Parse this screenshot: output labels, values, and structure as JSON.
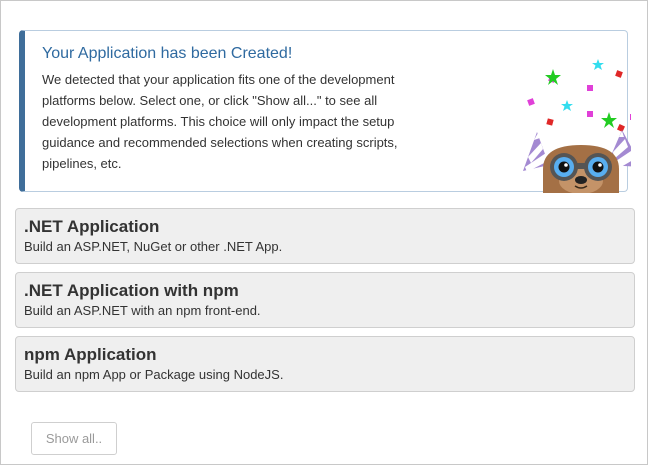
{
  "callout": {
    "title": "Your Application has been Created!",
    "body": "We detected that your application fits one of the development platforms below. Select one, or click \"Show all...\" to see all development platforms. This choice will only impact the setup guidance and recommended selections when creating scripts, pipelines, etc.",
    "accent_color": "#3f6e9a",
    "title_color": "#2f6aa0"
  },
  "options": [
    {
      "title": ".NET Application",
      "description": "Build an ASP.NET, NuGet or other .NET App."
    },
    {
      "title": ".NET Application with npm",
      "description": "Build an ASP.NET with an npm front-end."
    },
    {
      "title": "npm Application",
      "description": "Build an npm App or Package using NodeJS."
    }
  ],
  "show_all_label": "Show all..",
  "mascot": {
    "icon": "party-otter-mascot-icon"
  }
}
